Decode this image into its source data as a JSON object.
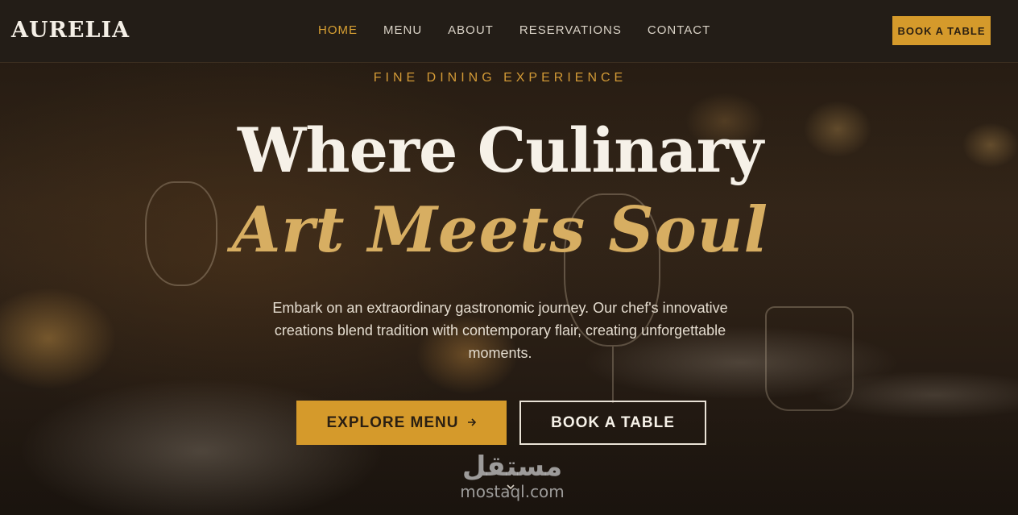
{
  "brand": {
    "logo": "AURELIA",
    "accent_color": "#d59a2b"
  },
  "nav": {
    "links": [
      {
        "label": "HOME",
        "active": true
      },
      {
        "label": "MENU",
        "active": false
      },
      {
        "label": "ABOUT",
        "active": false
      },
      {
        "label": "RESERVATIONS",
        "active": false
      },
      {
        "label": "CONTACT",
        "active": false
      }
    ],
    "cta_label": "BOOK A TABLE"
  },
  "hero": {
    "eyebrow": "FINE DINING EXPERIENCE",
    "title_line1": "Where Culinary",
    "title_line2": "Art Meets Soul",
    "lead": "Embark on an extraordinary gastronomic journey. Our chef's innovative creations blend tradition with contemporary flair, creating unforgettable moments.",
    "primary_button": "EXPLORE MENU",
    "primary_button_icon": "arrow-right-icon",
    "secondary_button": "BOOK A TABLE",
    "scroll_icon": "chevron-down-icon"
  },
  "watermark": {
    "arabic": "مستقل",
    "latin": "mostaql.com"
  }
}
